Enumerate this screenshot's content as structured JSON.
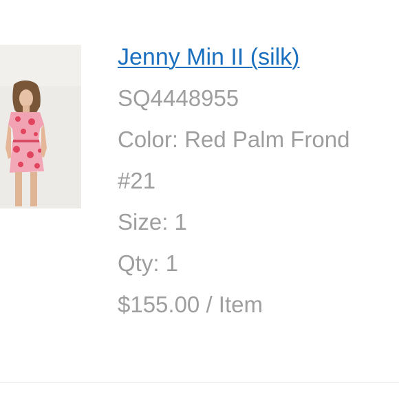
{
  "product": {
    "title": "Jenny Min II (silk)",
    "sku": "SQ4448955",
    "color_line": "Color: Red Palm Frond",
    "color_number": "#21",
    "size_line": "Size: 1",
    "qty_line": "Qty: 1",
    "price_line": "$155.00 / Item"
  },
  "colors": {
    "link": "#1a6fbf",
    "detail_text": "#9e9e9e",
    "divider": "#e3e3e3"
  }
}
